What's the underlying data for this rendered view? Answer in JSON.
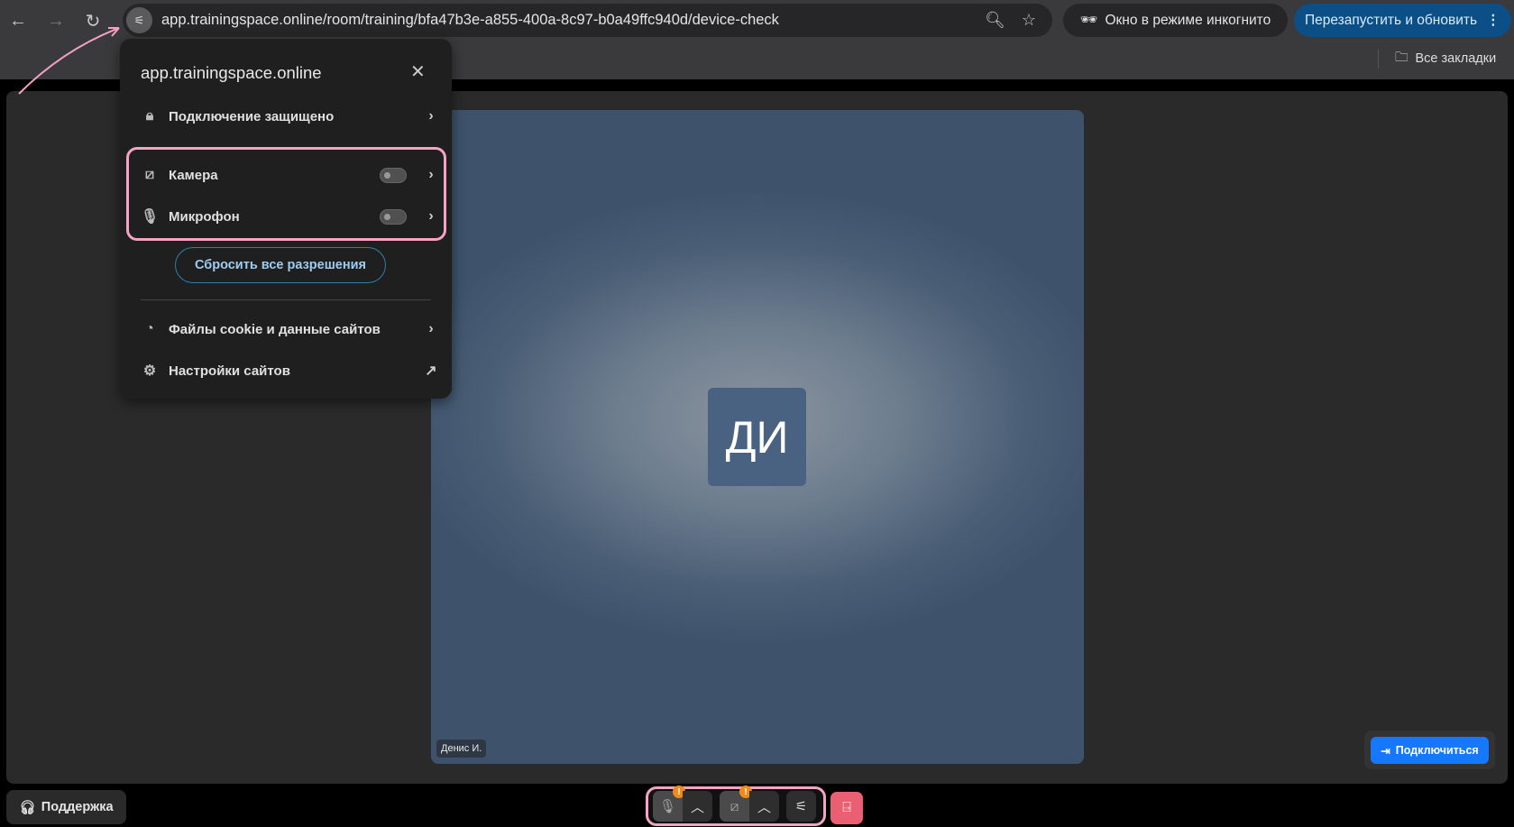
{
  "browser": {
    "url": "app.trainingspace.online/room/training/bfa47b3e-a855-400a-8c97-b0a49ffc940d/device-check",
    "incognito_label": "Окно в режиме инкогнито",
    "restart_label": "Перезапустить и обновить",
    "bookmarks_label": "Все закладки"
  },
  "popup": {
    "title": "app.trainingspace.online",
    "connection": "Подключение защищено",
    "camera": {
      "label": "Камера",
      "enabled": false
    },
    "microphone": {
      "label": "Микрофон",
      "enabled": false
    },
    "reset_label": "Сбросить все разрешения",
    "cookies": "Файлы cookie и данные сайтов",
    "site_settings": "Настройки сайтов"
  },
  "video": {
    "avatar_initials": "ДИ",
    "participant_name": "Денис И."
  },
  "controls": {
    "connect_label": "Подключиться",
    "support_label": "Поддержка",
    "mic_warning": "!",
    "cam_warning": "!"
  },
  "colors": {
    "accent": "#1677ff",
    "highlight": "#f4a3c2",
    "leave": "#eb5f73"
  }
}
